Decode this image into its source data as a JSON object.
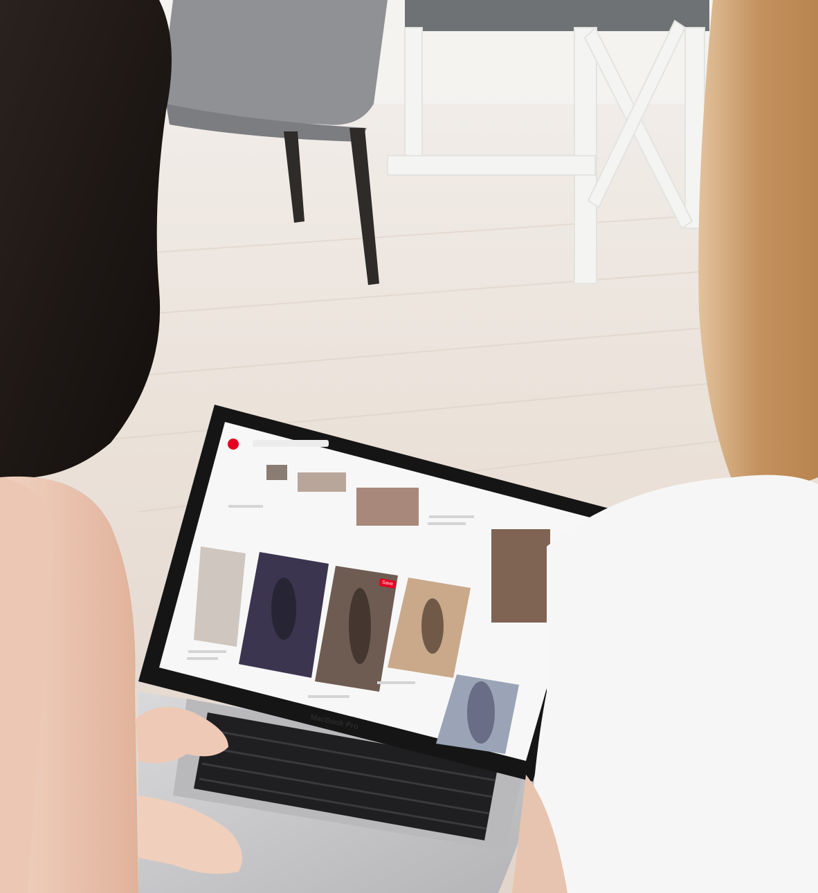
{
  "photo": {
    "laptop": {
      "brand_label": "MacBook Pro"
    },
    "screen": {
      "save_button_label": "Save"
    },
    "colors": {
      "floor": "#e7ded6",
      "wall": "#f2f1ef",
      "chair_seat": "#8f9194",
      "chair_legs": "#2e2b28",
      "stool_white": "#f4f4f2",
      "dark_hair": "#1b1614",
      "blonde_hair": "#c99a6c",
      "skin": "#e9c0aa",
      "white_shirt": "#f6f6f6",
      "laptop_silver": "#c9c9cb",
      "bezel": "#151515",
      "screen_bg": "#f7f7f7",
      "pinterest_red": "#e60023"
    }
  }
}
